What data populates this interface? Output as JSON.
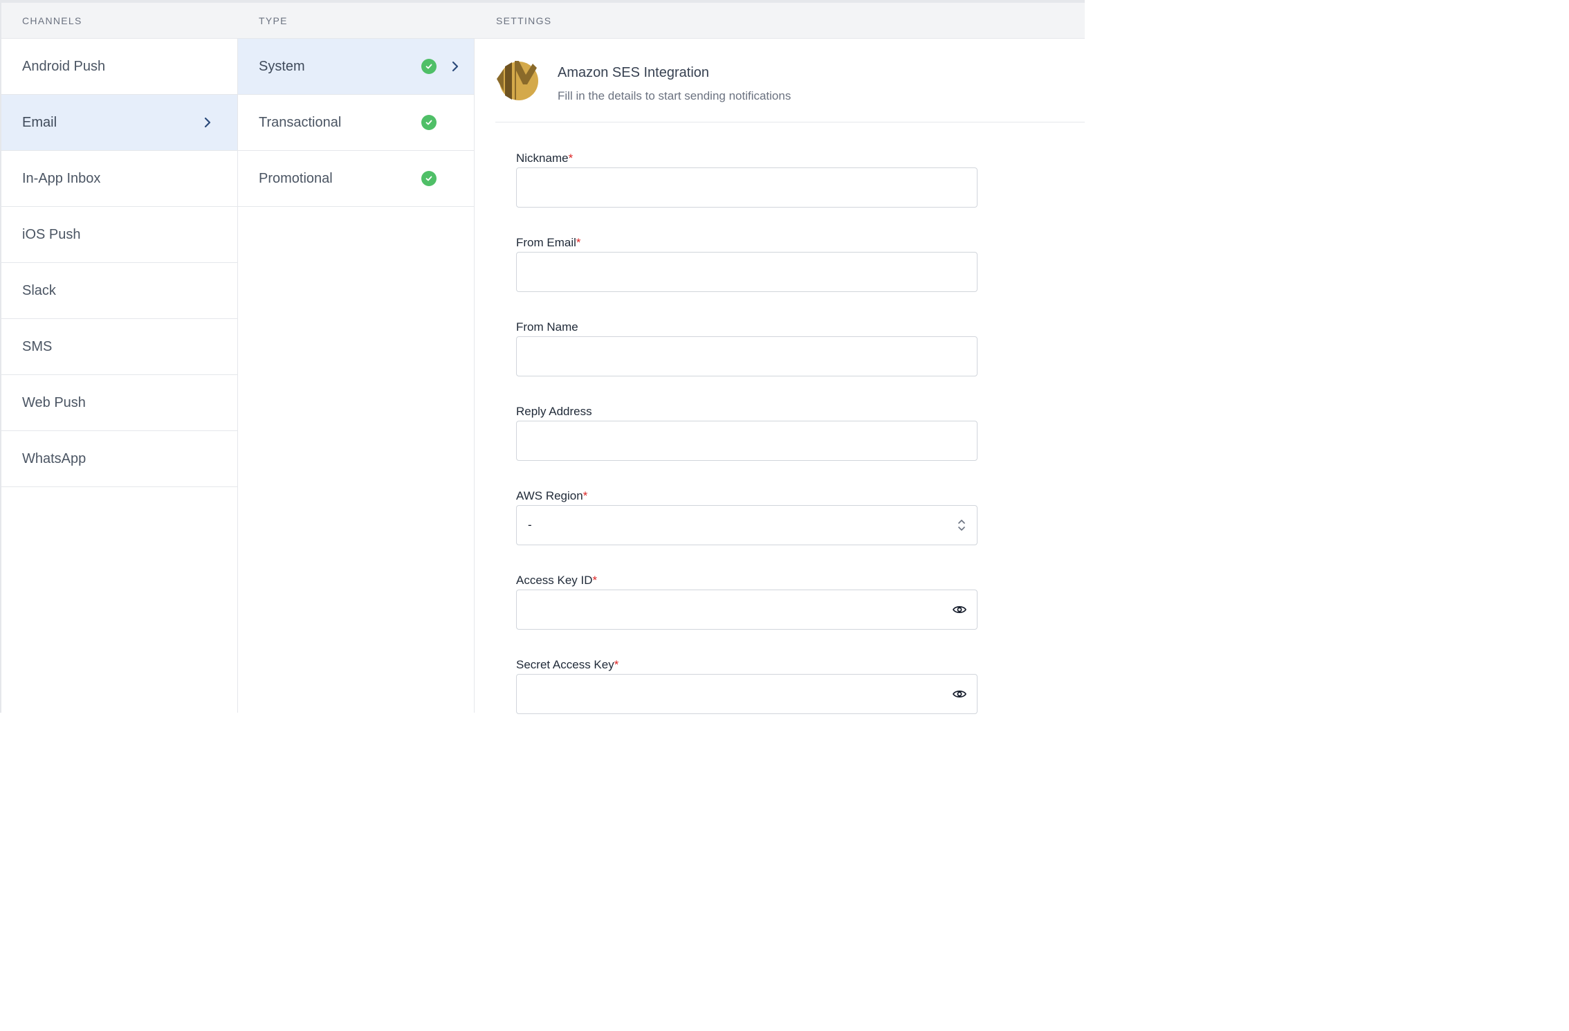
{
  "header": {
    "channels": "CHANNELS",
    "type": "TYPE",
    "settings": "SETTINGS"
  },
  "channels": [
    {
      "label": "Android Push",
      "active": false
    },
    {
      "label": "Email",
      "active": true
    },
    {
      "label": "In-App Inbox",
      "active": false
    },
    {
      "label": "iOS Push",
      "active": false
    },
    {
      "label": "Slack",
      "active": false
    },
    {
      "label": "SMS",
      "active": false
    },
    {
      "label": "Web Push",
      "active": false
    },
    {
      "label": "WhatsApp",
      "active": false
    }
  ],
  "types": [
    {
      "label": "System",
      "active": true,
      "configured": true
    },
    {
      "label": "Transactional",
      "active": false,
      "configured": true
    },
    {
      "label": "Promotional",
      "active": false,
      "configured": true
    }
  ],
  "settings": {
    "integration_title": "Amazon SES Integration",
    "integration_subtitle": "Fill in the details to start sending notifications",
    "logo_icon": "amazon-ses-logo-icon",
    "fields": {
      "nickname": {
        "label": "Nickname",
        "required": "*",
        "value": ""
      },
      "from_email": {
        "label": "From Email",
        "required": "*",
        "value": ""
      },
      "from_name": {
        "label": "From Name",
        "value": ""
      },
      "reply_address": {
        "label": "Reply Address",
        "value": ""
      },
      "aws_region": {
        "label": "AWS Region",
        "required": "*",
        "value": "-"
      },
      "access_key_id": {
        "label": "Access Key ID",
        "required": "*",
        "value": ""
      },
      "secret_access_key": {
        "label": "Secret Access Key",
        "required": "*",
        "value": ""
      }
    }
  },
  "colors": {
    "active_row": "#e6eefa",
    "check_green": "#4fbf67",
    "required_red": "#dc2626",
    "chevron_blue": "#2b4a7a"
  }
}
